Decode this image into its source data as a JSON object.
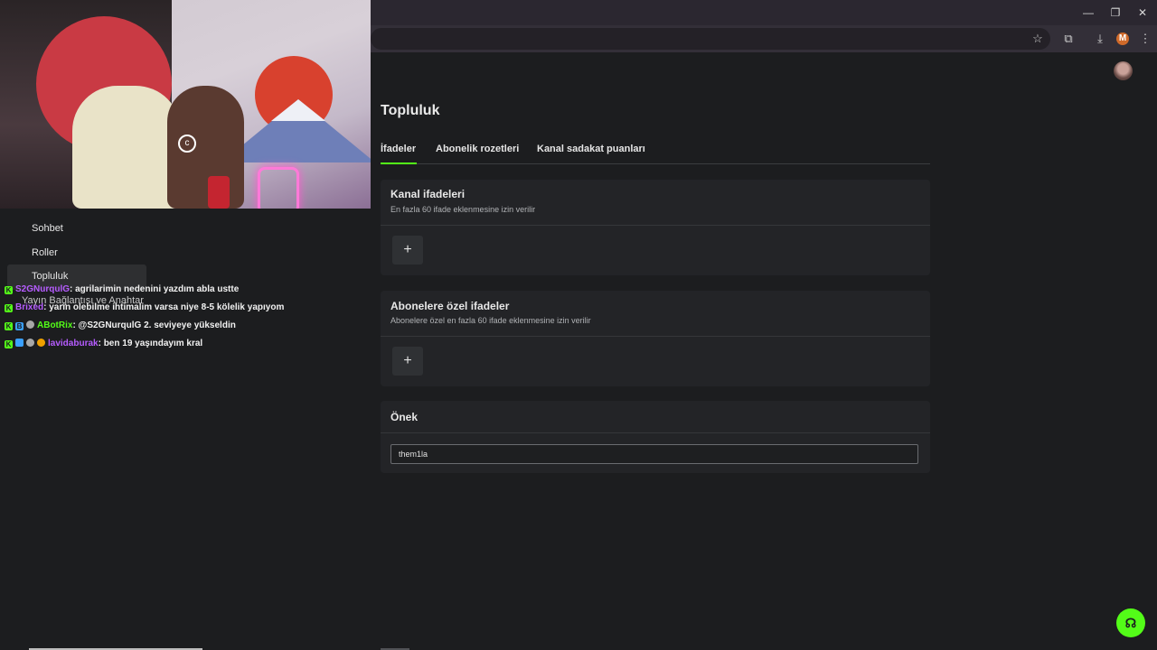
{
  "browser": {
    "window_buttons": [
      "—",
      "❐",
      "✕"
    ],
    "profile_letter": "M"
  },
  "sidebar": {
    "items": [
      {
        "label": "Sohbet"
      },
      {
        "label": "Roller"
      },
      {
        "label": "Topluluk"
      },
      {
        "label": "Yayın Bağlantısı ve Anahtar"
      }
    ]
  },
  "chat": {
    "messages": [
      {
        "user": "S2GNurqulG",
        "user_color": "#b65cff",
        "text": ": agrilarimin nedenini yazdım abla ustte"
      },
      {
        "user": "Brixed",
        "user_color": "#b65cff",
        "text": ": yarin olebilme ihtimalim varsa niye 8-5 kölelik yapıyom"
      },
      {
        "user": "ABotRix",
        "user_color": "#53fc18",
        "text": ": @S2GNurqulG 2. seviyeye yükseldin"
      },
      {
        "user": "lavidaburak",
        "user_color": "#b65cff",
        "text": ": ben 19 yaşındayım kral"
      }
    ]
  },
  "main": {
    "title": "Topluluk",
    "tabs": [
      {
        "label": "İfadeler",
        "active": true
      },
      {
        "label": "Abonelik rozetleri",
        "active": false
      },
      {
        "label": "Kanal sadakat puanları",
        "active": false
      }
    ],
    "channel_emotes": {
      "title": "Kanal ifadeleri",
      "subtitle": "En fazla 60 ifade eklenmesine izin verilir",
      "add_label": "+"
    },
    "sub_emotes": {
      "title": "Abonelere özel ifadeler",
      "subtitle": "Abonelere özel en fazla 60 ifade eklenmesine izin verilir",
      "add_label": "+"
    },
    "prefix": {
      "title": "Önek",
      "value": "them1la"
    }
  },
  "colors": {
    "accent": "#53fc18",
    "background": "#1c1d1f",
    "card": "#232427"
  }
}
